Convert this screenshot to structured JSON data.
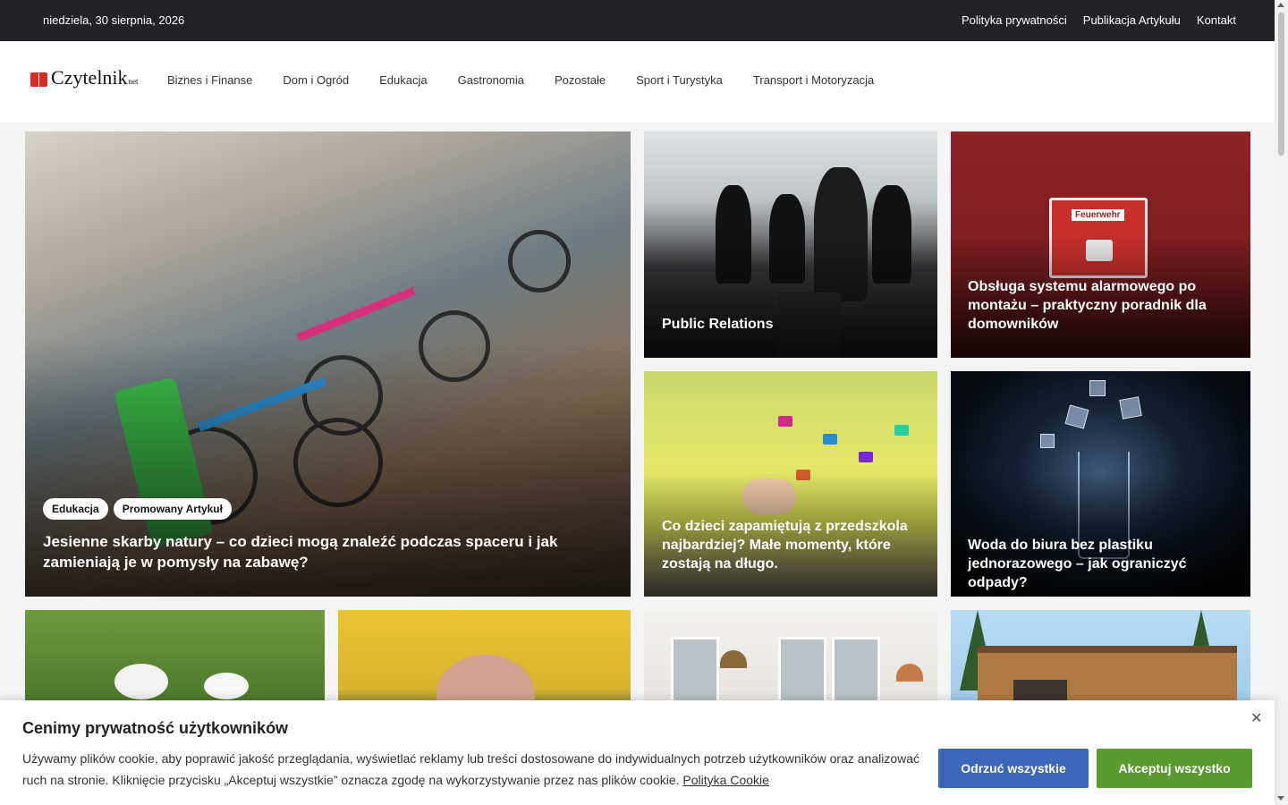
{
  "topbar": {
    "date": "niedziela, 30 sierpnia, 2026",
    "links": [
      "Polityka prywatności",
      "Publikacja Artykułu",
      "Kontakt"
    ]
  },
  "header": {
    "logo_text": "Czytelnik",
    "logo_suffix": "net",
    "nav": [
      "Biznes i Finanse",
      "Dom i Ogród",
      "Edukacja",
      "Gastronomia",
      "Pozostałe",
      "Sport i Turystyka",
      "Transport i Motoryzacja"
    ]
  },
  "featured": {
    "tags": [
      "Edukacja",
      "Promowany Artykuł"
    ],
    "title": "Jesienne skarby natury – co dzieci mogą znaleźć podczas spaceru i jak zamieniają je w pomysły na zabawę?"
  },
  "tiles": [
    {
      "title": "Public Relations"
    },
    {
      "title": "Obsługa systemu alarmowego po montażu – praktyczny poradnik dla domowników",
      "sign_text": "Feuerwehr"
    },
    {
      "title": "Co dzieci zapamiętują z przedszkola najbardziej? Małe momenty, które zostają na długo."
    },
    {
      "title": "Woda do biura bez plastiku jednorazowego – jak ograniczyć odpady?"
    }
  ],
  "cookie": {
    "title": "Cenimy prywatność użytkowników",
    "text": "Używamy plików cookie, aby poprawić jakość przeglądania, wyświetlać reklamy lub treści dostosowane do indywidualnych potrzeb użytkowników oraz analizować ruch na stronie. Kliknięcie przycisku „Akceptuj wszystkie” oznacza zgodę na wykorzystywanie przez nas plików cookie.",
    "link": "Polityka Cookie",
    "reject": "Odrzuć wszystkie",
    "accept": "Akceptuj wszystko",
    "close": "✕"
  },
  "colors": {
    "topbar": "#232226",
    "reject_button": "#3d66b8",
    "accept_button": "#5a9a2f",
    "logo_red": "#d62d20"
  }
}
